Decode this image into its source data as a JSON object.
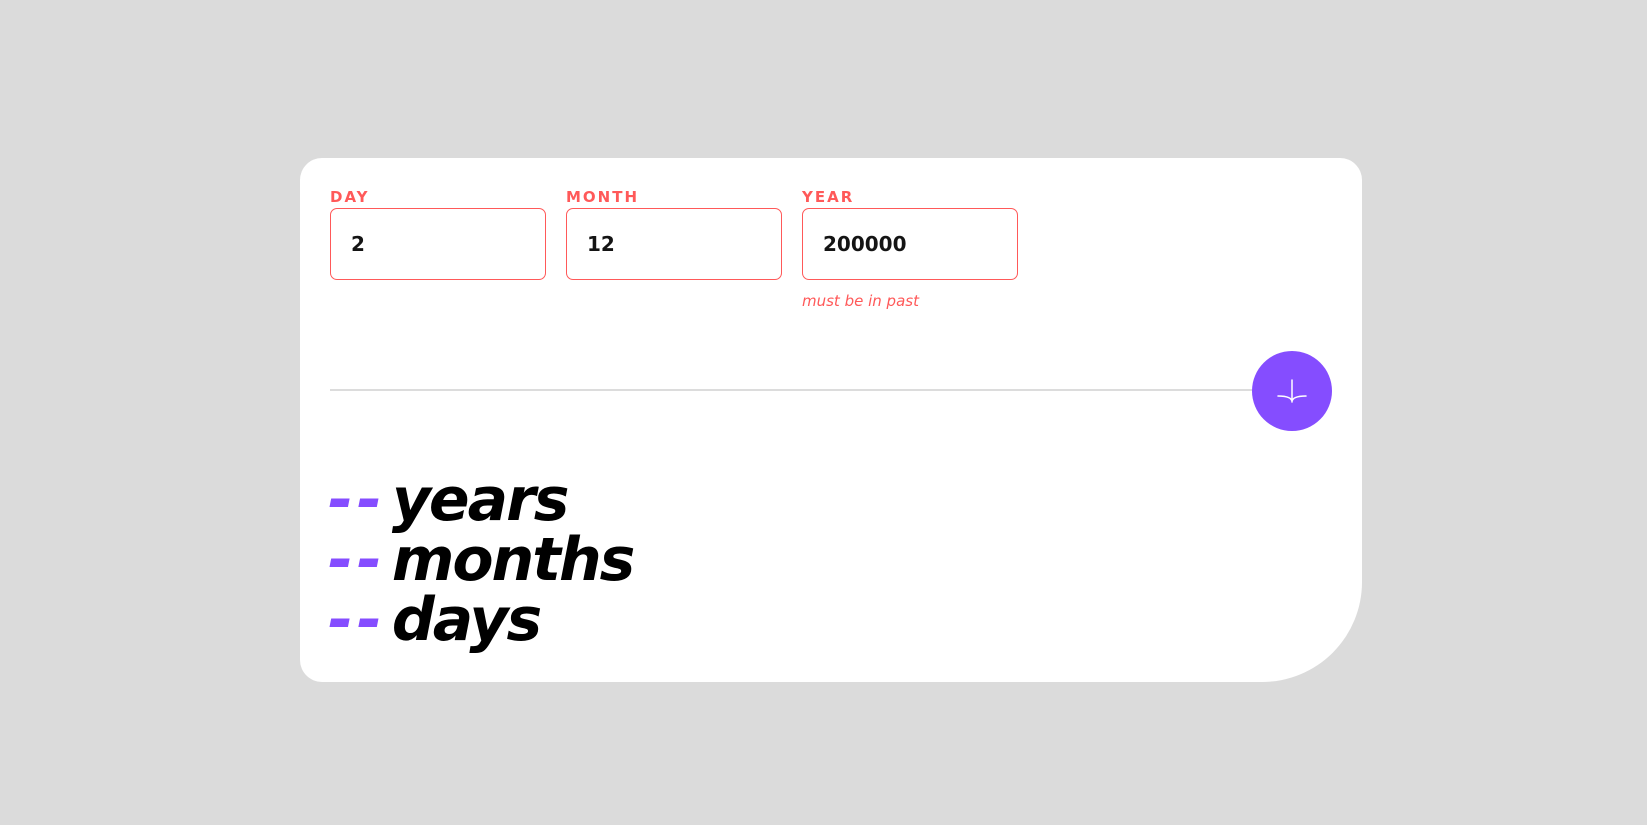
{
  "form": {
    "day": {
      "label": "DAY",
      "value": "2"
    },
    "month": {
      "label": "MONTH",
      "value": "12"
    },
    "year": {
      "label": "YEAR",
      "value": "200000",
      "error": "must be in past"
    }
  },
  "submit": {
    "icon": "arrow-down-icon"
  },
  "results": [
    {
      "value": "--",
      "unit": "years"
    },
    {
      "value": "--",
      "unit": "months"
    },
    {
      "value": "--",
      "unit": "days"
    }
  ],
  "colors": {
    "accent": "#854dff",
    "error": "#ff5959",
    "background": "#dbdbdb",
    "card": "#ffffff"
  }
}
